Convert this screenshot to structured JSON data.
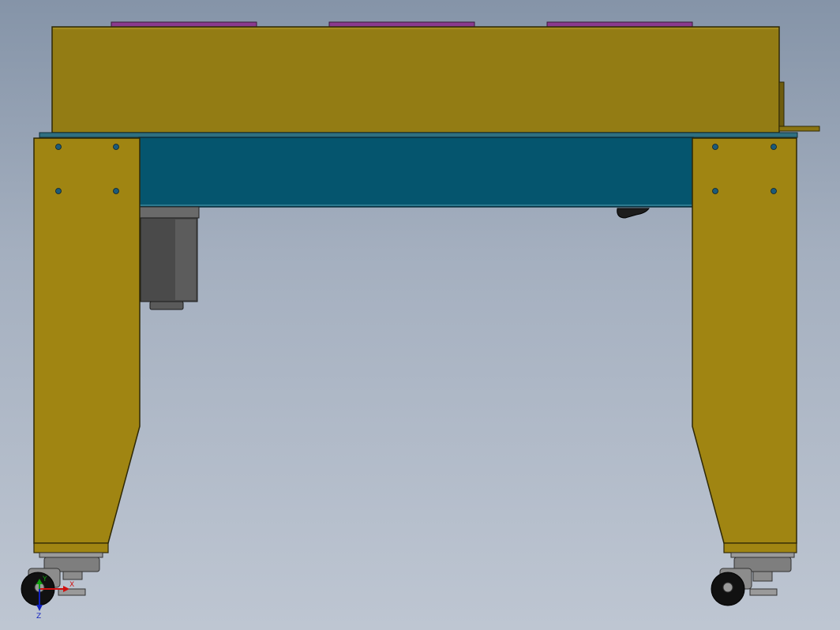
{
  "viewport": {
    "background_top": "#8594a8",
    "background_bottom": "#bec6d2"
  },
  "colors": {
    "housing": "#937c14",
    "housing_edge": "#3a3208",
    "leg": "#a08512",
    "beam": "#05556e",
    "bolt": "#1c5a78",
    "pad": "#8a3a8e",
    "motor_dark": "#3b3b3b",
    "motor_mid": "#5a5a5a",
    "caster_metal": "#8c8c8c",
    "wheel": "#111111"
  },
  "triad": {
    "x_label": "X",
    "y_label": "Y",
    "z_label": "Z",
    "x_color": "#d01010",
    "y_color": "#10a010",
    "z_color": "#1020c0"
  }
}
